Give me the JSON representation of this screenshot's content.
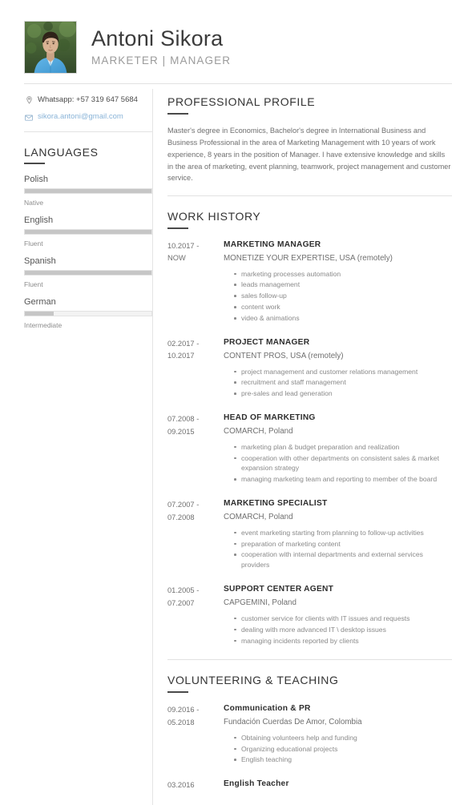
{
  "header": {
    "name": "Antoni Sikora",
    "subtitle": "MARKETER | MANAGER",
    "photo_alt": "portrait-photo"
  },
  "contact": {
    "items": [
      {
        "icon": "location-pin-icon",
        "text": "Whatsapp: +57 319 647 5684",
        "is_link": false
      },
      {
        "icon": "envelope-icon",
        "text": "sikora.antoni@gmail.com",
        "is_link": true
      }
    ]
  },
  "languages": {
    "heading": "LANGUAGES",
    "items": [
      {
        "name": "Polish",
        "level": "Native",
        "percent": 100
      },
      {
        "name": "English",
        "level": "Fluent",
        "percent": 100
      },
      {
        "name": "Spanish",
        "level": "Fluent",
        "percent": 100
      },
      {
        "name": "German",
        "level": "Intermediate",
        "percent": 23
      }
    ]
  },
  "profile": {
    "heading": "PROFESSIONAL PROFILE",
    "text": "Master's degree in Economics, Bachelor's degree in International Business and Business Professional in the area of Marketing Management with 10 years of work experience, 8 years in the position of Manager. I have extensive knowledge and skills in the area of marketing, event planning, teamwork, project management and customer service."
  },
  "work_history": {
    "heading": "WORK HISTORY",
    "entries": [
      {
        "date_from": "10.2017 -",
        "date_to": "NOW",
        "title": "MARKETING MANAGER",
        "org": "MONETIZE YOUR EXPERTISE, USA (remotely)",
        "bullets": [
          "marketing processes automation",
          "leads management",
          "sales follow-up",
          "content work",
          "video & animations"
        ]
      },
      {
        "date_from": "02.2017 -",
        "date_to": "10.2017",
        "title": "PROJECT MANAGER",
        "org": "CONTENT PROS, USA (remotely)",
        "bullets": [
          "project management and customer relations management",
          "recruitment and staff management",
          "pre-sales and lead generation"
        ]
      },
      {
        "date_from": "07.2008 -",
        "date_to": "09.2015",
        "title": "HEAD OF MARKETING",
        "org": "COMARCH, Poland",
        "bullets": [
          "marketing plan & budget preparation and realization",
          "cooperation with other departments on consistent sales & market expansion strategy",
          "managing marketing team and reporting to member of the board"
        ]
      },
      {
        "date_from": "07.2007 -",
        "date_to": "07.2008",
        "title": "MARKETING SPECIALIST",
        "org": "COMARCH, Poland",
        "bullets": [
          "event marketing starting from planning to follow-up activities",
          "preparation of marketing content",
          "cooperation with  internal departments and external services providers"
        ]
      },
      {
        "date_from": "01.2005 -",
        "date_to": "07.2007",
        "title": "SUPPORT CENTER AGENT",
        "org": "CAPGEMINI, Poland",
        "bullets": [
          "customer service for clients with IT issues and requests",
          "dealing with more advanced IT \\ desktop issues",
          "managing incidents reported by clients"
        ]
      }
    ]
  },
  "volunteering": {
    "heading": "VOLUNTEERING & TEACHING",
    "entries": [
      {
        "date_from": "09.2016 -",
        "date_to": "05.2018",
        "title": "Communication & PR",
        "org": "Fundación Cuerdas De Amor, Colombia",
        "bullets": [
          "Obtaining volunteers help and funding",
          "Organizing educational projects",
          "English teaching"
        ]
      },
      {
        "date_from": "03.2016",
        "date_to": "",
        "title": "English Teacher",
        "org": "",
        "bullets": []
      }
    ]
  },
  "colors": {
    "text_dark": "#3a3a3a",
    "text_muted": "#8a8a8a",
    "link_blue": "#8ab4d8",
    "rule": "#e2e2e2",
    "bar_fill": "#c6c6c6",
    "bar_track": "#f3f3f3"
  }
}
